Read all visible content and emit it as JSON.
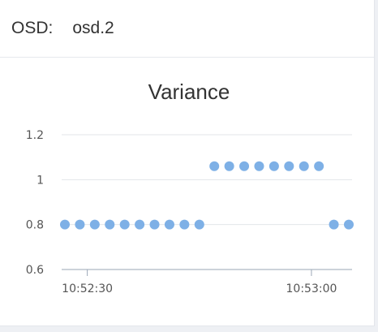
{
  "header": {
    "label": "OSD:",
    "value": "osd.2"
  },
  "chart_data": {
    "type": "scatter",
    "title": "Variance",
    "xlabel": "",
    "ylabel": "",
    "ylim": [
      0.6,
      1.2
    ],
    "xlim": [
      "10:52:27",
      "10:53:05"
    ],
    "y_ticks": [
      {
        "value": 0.6,
        "label": "0.6"
      },
      {
        "value": 0.8,
        "label": "0.8"
      },
      {
        "value": 1.0,
        "label": "1"
      },
      {
        "value": 1.2,
        "label": "1.2"
      }
    ],
    "x_ticks": [
      {
        "value": "10:52:30",
        "label": "10:52:30"
      },
      {
        "value": "10:53:00",
        "label": "10:53:00"
      }
    ],
    "grid": true,
    "color": "#7eb0e6",
    "points": [
      {
        "x": "10:52:27",
        "y": 0.8
      },
      {
        "x": "10:52:29",
        "y": 0.8
      },
      {
        "x": "10:52:31",
        "y": 0.8
      },
      {
        "x": "10:52:33",
        "y": 0.8
      },
      {
        "x": "10:52:35",
        "y": 0.8
      },
      {
        "x": "10:52:37",
        "y": 0.8
      },
      {
        "x": "10:52:39",
        "y": 0.8
      },
      {
        "x": "10:52:41",
        "y": 0.8
      },
      {
        "x": "10:52:43",
        "y": 0.8
      },
      {
        "x": "10:52:45",
        "y": 0.8
      },
      {
        "x": "10:52:47",
        "y": 1.06
      },
      {
        "x": "10:52:49",
        "y": 1.06
      },
      {
        "x": "10:52:51",
        "y": 1.06
      },
      {
        "x": "10:52:53",
        "y": 1.06
      },
      {
        "x": "10:52:55",
        "y": 1.06
      },
      {
        "x": "10:52:57",
        "y": 1.06
      },
      {
        "x": "10:52:59",
        "y": 1.06
      },
      {
        "x": "10:53:01",
        "y": 1.06
      },
      {
        "x": "10:53:03",
        "y": 0.8
      },
      {
        "x": "10:53:05",
        "y": 0.8
      }
    ]
  }
}
